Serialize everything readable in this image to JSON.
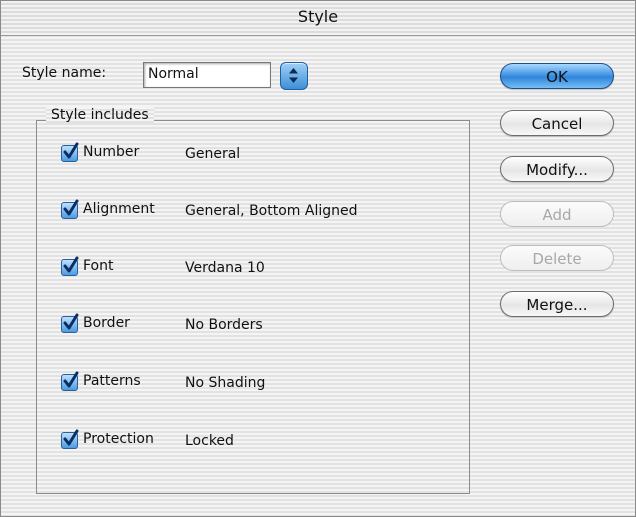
{
  "window": {
    "title": "Style"
  },
  "style_name": {
    "label": "Style name:",
    "value": "Normal",
    "popup_icon": "up-down-arrows-icon"
  },
  "group": {
    "legend": "Style includes",
    "items": [
      {
        "name": "Number",
        "value": "General",
        "checked": true
      },
      {
        "name": "Alignment",
        "value": "General, Bottom Aligned",
        "checked": true
      },
      {
        "name": "Font",
        "value": "Verdana 10",
        "checked": true
      },
      {
        "name": "Border",
        "value": "No Borders",
        "checked": true
      },
      {
        "name": "Patterns",
        "value": "No Shading",
        "checked": true
      },
      {
        "name": "Protection",
        "value": "Locked",
        "checked": true
      }
    ]
  },
  "buttons": {
    "ok": "OK",
    "cancel": "Cancel",
    "modify": "Modify...",
    "add": "Add",
    "delete": "Delete",
    "merge": "Merge..."
  },
  "colors": {
    "accent": "#2f86dc",
    "check": "#0a2f66"
  }
}
